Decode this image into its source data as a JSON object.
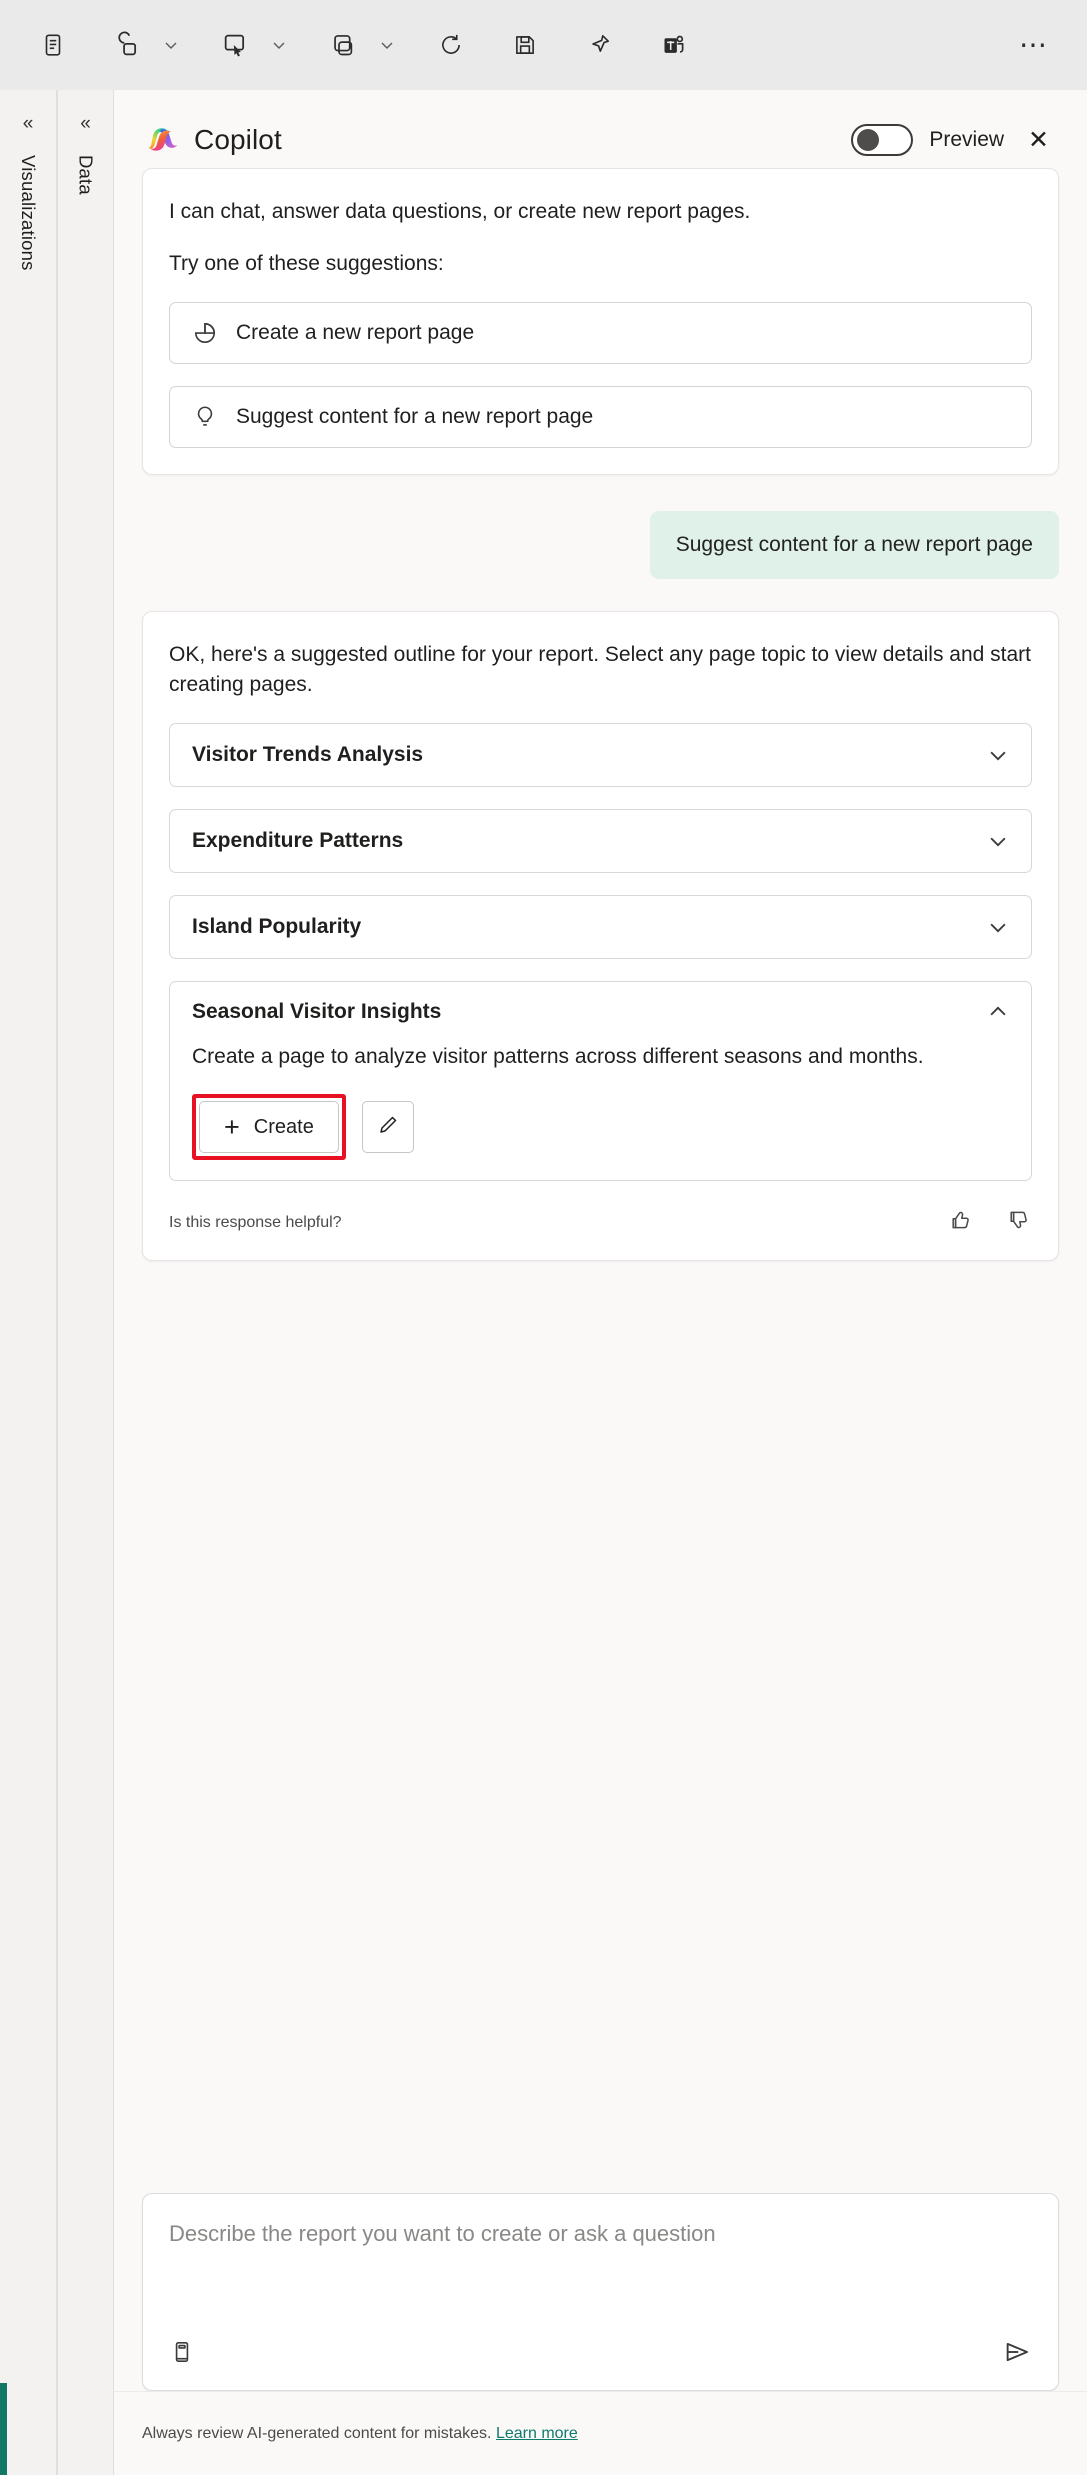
{
  "toolbar": {
    "items": [
      {
        "name": "page-view-icon",
        "caret": false
      },
      {
        "name": "copy-visual-icon",
        "caret": true
      },
      {
        "name": "paste-icon",
        "caret": true
      },
      {
        "name": "duplicate-page-icon",
        "caret": true
      },
      {
        "name": "refresh-icon",
        "caret": false
      },
      {
        "name": "save-icon",
        "caret": false
      },
      {
        "name": "pin-icon",
        "caret": false
      },
      {
        "name": "teams-chat-icon",
        "caret": false
      }
    ],
    "overflow_label": "⋯"
  },
  "rails": [
    {
      "chevron": "«",
      "label": "Visualizations"
    },
    {
      "chevron": "«",
      "label": "Data"
    }
  ],
  "header": {
    "title": "Copilot",
    "preview_label": "Preview",
    "toggle_state": "off",
    "close_label": "✕"
  },
  "intro_card": {
    "line1": "I can chat, answer data questions, or create new report pages.",
    "line2": "Try one of these suggestions:",
    "suggestions": [
      {
        "icon": "pie-chart-icon",
        "label": "Create a new report page"
      },
      {
        "icon": "lightbulb-icon",
        "label": "Suggest content for a new report page"
      }
    ]
  },
  "user_message": "Suggest content for a new report page",
  "response": {
    "intro": "OK, here's a suggested outline for your report. Select any page topic to view details and start creating pages.",
    "topics": [
      {
        "title": "Visitor Trends Analysis",
        "expanded": false,
        "chevron": "down"
      },
      {
        "title": "Expenditure Patterns",
        "expanded": false,
        "chevron": "down"
      },
      {
        "title": "Island Popularity",
        "expanded": false,
        "chevron": "down"
      },
      {
        "title": "Seasonal Visitor Insights",
        "expanded": true,
        "chevron": "up",
        "description": "Create a page to analyze visitor patterns across different seasons and months.",
        "create_label": "Create",
        "plus_glyph": "+",
        "edit_icon": "pencil-icon",
        "highlighted": true
      }
    ],
    "feedback_text": "Is this response helpful?",
    "thumbs_up_icon": "thumbs-up-icon",
    "thumbs_down_icon": "thumbs-down-icon"
  },
  "composer": {
    "placeholder": "Describe the report you want to create or ask a question",
    "value": "",
    "prompt_guide_icon": "prompt-guide-icon",
    "send_icon": "send-icon"
  },
  "footer": {
    "text": "Always review AI-generated content for mistakes.",
    "link": "Learn more"
  },
  "colors": {
    "accent_green": "#117865",
    "user_bubble": "#dff1e8",
    "highlight_red": "#e81123",
    "link": "#0f7b6c"
  }
}
